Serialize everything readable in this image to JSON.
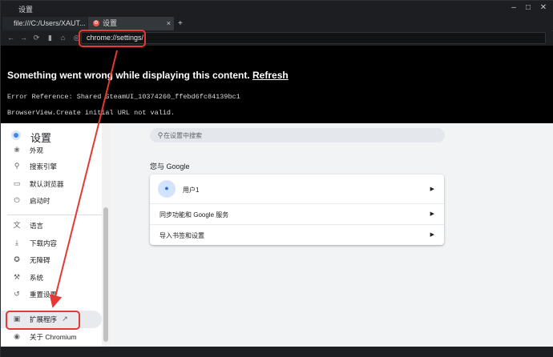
{
  "window": {
    "title": "设置",
    "min_icon": "minimize-icon",
    "max_icon": "maximize-icon",
    "close_icon": "close-icon"
  },
  "tabs": [
    {
      "label": "file:///C:/Users/XAUT..."
    },
    {
      "label": "设置",
      "icon": "settings-favicon-icon"
    }
  ],
  "tab_close": "×",
  "new_tab": "+",
  "toolbar": {
    "icons": [
      "back-icon",
      "forward-icon",
      "reload-icon",
      "bookmark-icon",
      "home-icon",
      "site-info-icon"
    ],
    "address": "chrome://settings/"
  },
  "error": {
    "heading_prefix": "Something went wrong while displaying this content. ",
    "refresh_label": "Refresh",
    "reference": "Error Reference: Shared SteamUI_10374260_ffebd6fc84139bc1",
    "message": "BrowserView.Create initial URL not valid."
  },
  "settings": {
    "title": "设置",
    "search_placeholder": "在设置中搜索",
    "nav": [
      {
        "label": "外观",
        "icon": "palette-icon"
      },
      {
        "label": "搜索引擎",
        "icon": "search-icon"
      },
      {
        "label": "默认浏览器",
        "icon": "browser-icon"
      },
      {
        "label": "启动时",
        "icon": "power-icon"
      },
      {
        "label": "语言",
        "icon": "translate-icon"
      },
      {
        "label": "下载内容",
        "icon": "download-icon"
      },
      {
        "label": "无障碍",
        "icon": "accessibility-icon"
      },
      {
        "label": "系统",
        "icon": "wrench-icon"
      },
      {
        "label": "重置设置",
        "icon": "reset-icon"
      },
      {
        "label": "扩展程序",
        "icon": "extension-icon"
      },
      {
        "label": "关于 Chromium",
        "icon": "chromium-logo-icon"
      }
    ],
    "section_title": "您与 Google",
    "rows": [
      {
        "label": "用户1"
      },
      {
        "label": "同步功能和 Google 服务"
      },
      {
        "label": "导入书签和设置"
      }
    ]
  },
  "colors": {
    "annotation_red": "#e53935",
    "chrome_dark": "#1c1e21",
    "accent_blue": "#1a73e8"
  }
}
